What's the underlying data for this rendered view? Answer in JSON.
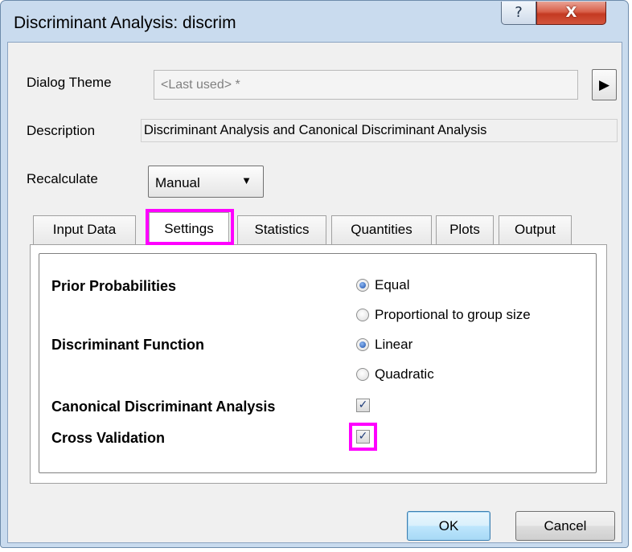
{
  "window": {
    "title": "Discriminant Analysis: discrim",
    "help_glyph": "?",
    "close_glyph": "X"
  },
  "dialog_theme": {
    "label": "Dialog Theme",
    "value": "<Last used> *",
    "arrow_glyph": "▶"
  },
  "description": {
    "label": "Description",
    "value": "Discriminant Analysis and Canonical Discriminant Analysis"
  },
  "recalculate": {
    "label": "Recalculate",
    "selected": "Manual",
    "chevron": "▼"
  },
  "tabs": [
    {
      "label": "Input Data",
      "active": false
    },
    {
      "label": "Settings",
      "active": true
    },
    {
      "label": "Statistics",
      "active": false
    },
    {
      "label": "Quantities",
      "active": false
    },
    {
      "label": "Plots",
      "active": false
    },
    {
      "label": "Output",
      "active": false
    }
  ],
  "settings": {
    "prior_probabilities": {
      "label": "Prior Probabilities",
      "options": [
        {
          "label": "Equal",
          "selected": true
        },
        {
          "label": "Proportional to group size",
          "selected": false
        }
      ]
    },
    "discriminant_function": {
      "label": "Discriminant Function",
      "options": [
        {
          "label": "Linear",
          "selected": true
        },
        {
          "label": "Quadratic",
          "selected": false
        }
      ]
    },
    "canonical_discriminant_analysis": {
      "label": "Canonical Discriminant Analysis",
      "checked": true
    },
    "cross_validation": {
      "label": "Cross Validation",
      "checked": true
    },
    "check_glyph": "✓"
  },
  "buttons": {
    "ok": "OK",
    "cancel": "Cancel"
  },
  "colors": {
    "highlight": "#ff00ff",
    "window_frame": "#c9dbee",
    "close_button": "#c43a22"
  }
}
